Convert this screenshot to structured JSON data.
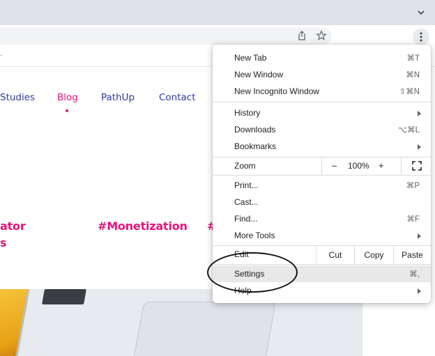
{
  "browser": {
    "tab_chevron_icon": "chevron-down-icon",
    "share_icon": "share-icon",
    "bookmark_icon": "star-icon",
    "menu_icon": "vertical-dots-icon"
  },
  "page": {
    "nav": [
      "Studies",
      "Blog",
      "PathUp",
      "Contact"
    ],
    "active_nav": "Blog",
    "tags": [
      "ator",
      "s",
      "#Monetization",
      "#"
    ],
    "accent_color": "#e5157b",
    "nav_color": "#2b3b9e"
  },
  "menu": {
    "group1": [
      {
        "label": "New Tab",
        "shortcut": "⌘T"
      },
      {
        "label": "New Window",
        "shortcut": "⌘N"
      },
      {
        "label": "New Incognito Window",
        "shortcut": "⇧⌘N"
      }
    ],
    "group2": [
      {
        "label": "History",
        "submenu": true
      },
      {
        "label": "Downloads",
        "shortcut": "⌥⌘L"
      },
      {
        "label": "Bookmarks",
        "submenu": true
      }
    ],
    "zoom": {
      "label": "Zoom",
      "minus": "–",
      "value": "100%",
      "plus": "+",
      "fullscreen_icon": "fullscreen-icon"
    },
    "group3": [
      {
        "label": "Print...",
        "shortcut": "⌘P"
      },
      {
        "label": "Cast..."
      },
      {
        "label": "Find...",
        "shortcut": "⌘F"
      },
      {
        "label": "More Tools",
        "submenu": true
      }
    ],
    "edit": {
      "label": "Edit",
      "cut": "Cut",
      "copy": "Copy",
      "paste": "Paste"
    },
    "group4": [
      {
        "label": "Settings",
        "shortcut": "⌘,",
        "highlighted": true
      },
      {
        "label": "Help",
        "submenu": true
      }
    ]
  }
}
